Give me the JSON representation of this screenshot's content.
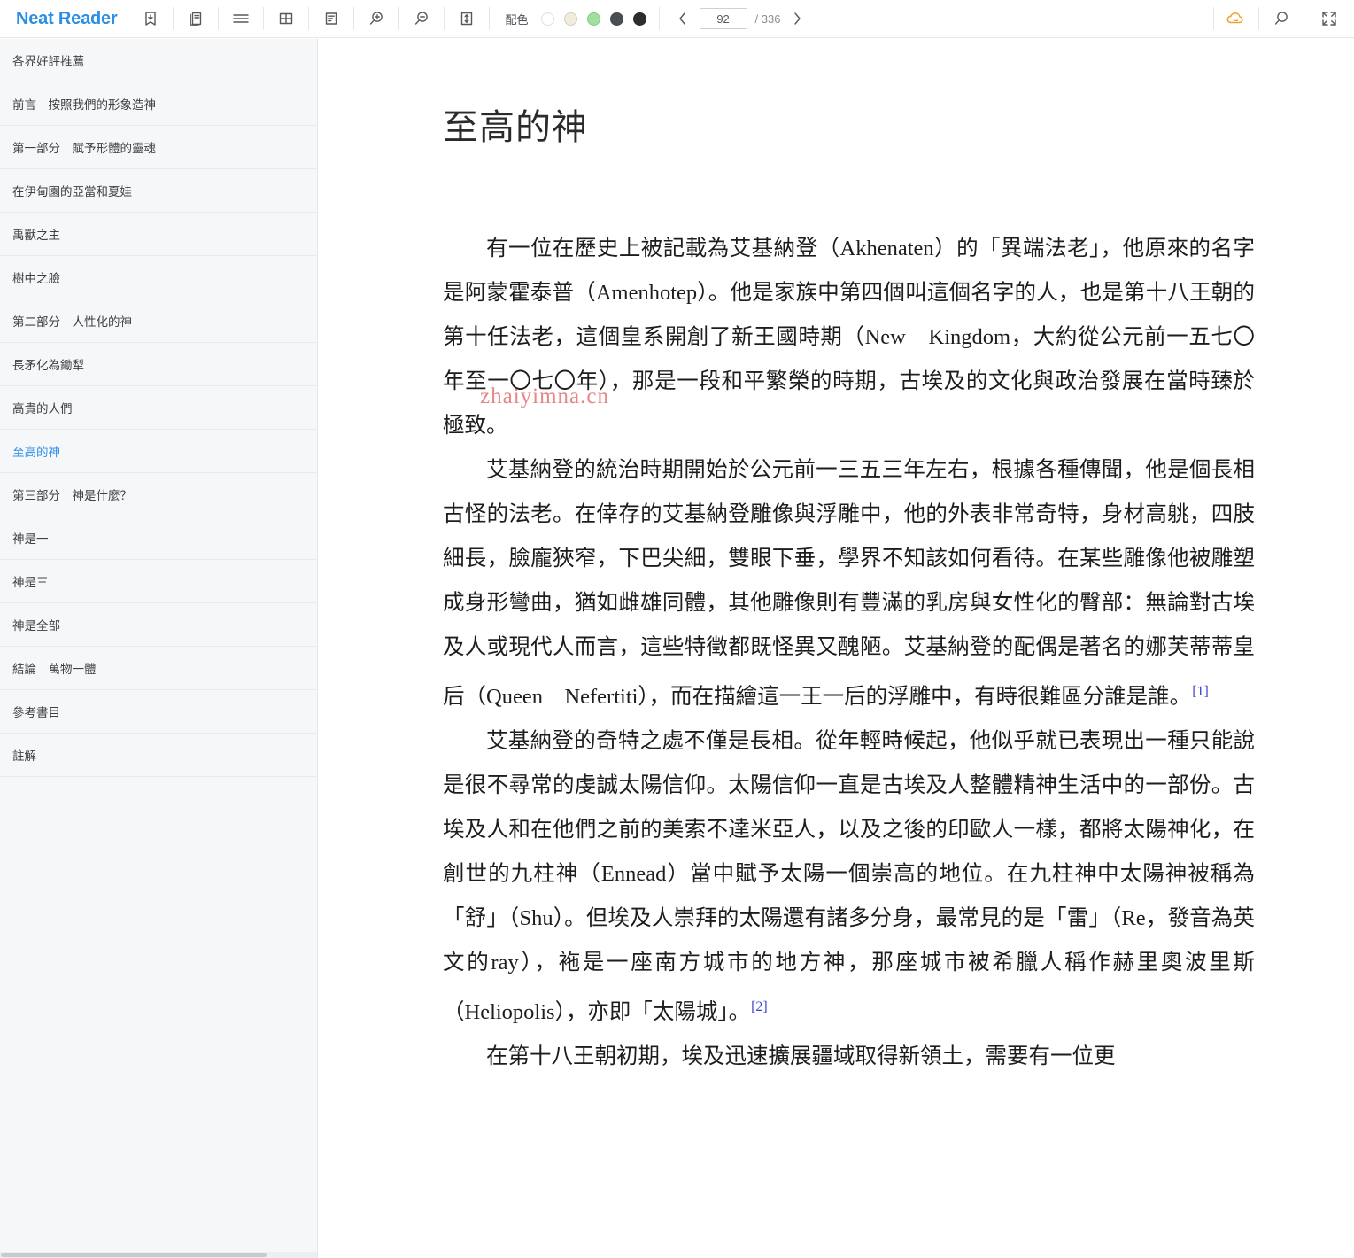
{
  "app": {
    "brand": "Neat Reader"
  },
  "toolbar": {
    "icons": [
      {
        "name": "save-book-icon",
        "label": "save-book"
      },
      {
        "name": "library-icon",
        "label": "library"
      },
      {
        "name": "menu-icon",
        "label": "contents"
      },
      {
        "name": "grid-icon",
        "label": "grid-view"
      },
      {
        "name": "notes-icon",
        "label": "notes"
      },
      {
        "name": "zoom-in-icon",
        "label": "zoom-in"
      },
      {
        "name": "zoom-out-icon",
        "label": "zoom-out"
      },
      {
        "name": "line-height-icon",
        "label": "line-height"
      }
    ],
    "color_scheme": {
      "label": "配色",
      "swatches": [
        "#ffffff",
        "#f2ecdc",
        "#9fe09f",
        "#4b4e52",
        "#2b2d30"
      ],
      "selected_index": 0
    },
    "pager": {
      "prev_label": "‹",
      "next_label": "›",
      "current_page": "92",
      "page_placeholder": "92",
      "total_label": "/ 336"
    },
    "right_icons": [
      {
        "name": "cloud-sync-icon",
        "label": "cloud-sync",
        "color": "#f0a030"
      },
      {
        "name": "search-icon",
        "label": "search"
      },
      {
        "name": "fullscreen-icon",
        "label": "fullscreen"
      }
    ]
  },
  "sidebar": {
    "items": [
      {
        "label": "各界好評推薦",
        "active": false
      },
      {
        "label": "前言　按照我們的形象造神",
        "active": false
      },
      {
        "label": "第一部分　賦予形體的靈魂",
        "active": false
      },
      {
        "label": "在伊甸園的亞當和夏娃",
        "active": false
      },
      {
        "label": "禹獸之主",
        "active": false
      },
      {
        "label": "樹中之臉",
        "active": false
      },
      {
        "label": "第二部分　人性化的神",
        "active": false
      },
      {
        "label": "長矛化為鋤犁",
        "active": false
      },
      {
        "label": "高貴的人們",
        "active": false
      },
      {
        "label": "至高的神",
        "active": true
      },
      {
        "label": "第三部分　神是什麼？",
        "active": false
      },
      {
        "label": "神是一",
        "active": false
      },
      {
        "label": "神是三",
        "active": false
      },
      {
        "label": "神是全部",
        "active": false
      },
      {
        "label": "結論　萬物一體",
        "active": false
      },
      {
        "label": "參考書目",
        "active": false
      },
      {
        "label": "註解",
        "active": false
      }
    ]
  },
  "document": {
    "title": "至高的神",
    "watermark": "zhaiyimna.cn",
    "paragraphs": [
      {
        "text": "有一位在歷史上被記載為艾基納登（Akhenaten）的「異端法老」，他原來的名字是阿蒙霍泰普（Amenhotep）。他是家族中第四個叫這個名字的人，也是第十八王朝的第十任法老，這個皇系開創了新王國時期（New　Kingdom，大約從公元前一五七〇年至一〇七〇年），那是一段和平繁榮的時期，古埃及的文化與政治發展在當時臻於極致。",
        "footnote": ""
      },
      {
        "text": "艾基納登的統治時期開始於公元前一三五三年左右，根據各種傳聞，他是個長相古怪的法老。在倖存的艾基納登雕像與浮雕中，他的外表非常奇特，身材高䠷，四肢細長，臉龐狹窄，下巴尖細，雙眼下垂，學界不知該如何看待。在某些雕像他被雕塑成身形彎曲，猶如雌雄同體，其他雕像則有豐滿的乳房與女性化的臀部：無論對古埃及人或現代人而言，這些特徵都既怪異又醜陋。艾基納登的配偶是著名的娜芙蒂蒂皇后（Queen　Nefertiti），而在描繪這一王一后的浮雕中，有時很難區分誰是誰。",
        "footnote": "[1]"
      },
      {
        "text": "艾基納登的奇特之處不僅是長相。從年輕時候起，他似乎就已表現出一種只能說是很不尋常的虔誠太陽信仰。太陽信仰一直是古埃及人整體精神生活中的一部份。古埃及人和在他們之前的美索不達米亞人，以及之後的印歐人一樣，都將太陽神化，在創世的九柱神（Ennead）當中賦予太陽一個崇高的地位。在九柱神中太陽神被稱為「舒」（Shu）。但埃及人崇拜的太陽還有諸多分身，最常見的是「雷」（Re，發音為英文的ray），袘是一座南方城市的地方神，那座城市被希臘人稱作赫里奧波里斯（Heliopolis），亦即「太陽城」。",
        "footnote": "[2]"
      },
      {
        "text": "在第十八王朝初期，埃及迅速擴展疆域取得新領土，需要有一位更",
        "footnote": ""
      }
    ]
  }
}
